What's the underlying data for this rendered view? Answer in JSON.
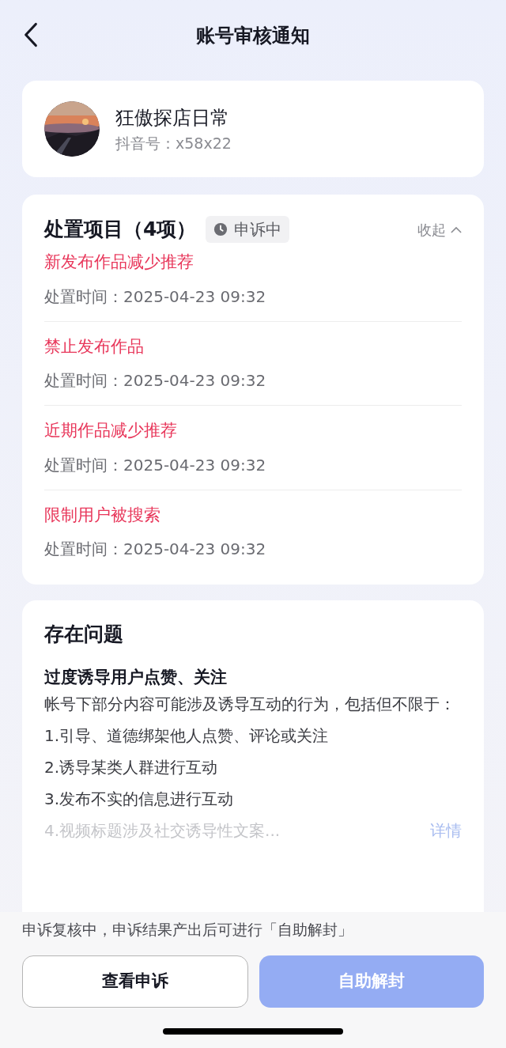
{
  "header": {
    "title": "账号审核通知"
  },
  "account": {
    "name": "狂傲探店日常",
    "id_label": "抖音号：x58x22"
  },
  "measures": {
    "title": "处置项目（4项）",
    "status": "申诉中",
    "toggle": "收起",
    "expanded": true,
    "items": [
      {
        "title": "新发布作品减少推荐",
        "time": "处置时间：2025-04-23 09:32"
      },
      {
        "title": "禁止发布作品",
        "time": "处置时间：2025-04-23 09:32"
      },
      {
        "title": "近期作品减少推荐",
        "time": "处置时间：2025-04-23 09:32"
      },
      {
        "title": "限制用户被搜索",
        "time": "处置时间：2025-04-23 09:32"
      }
    ]
  },
  "issues": {
    "title": "存在问题",
    "subtitle": "过度诱导用户点赞、关注",
    "description": "帐号下部分内容可能涉及诱导互动的行为，包括但不限于：",
    "points": [
      "1.引导、道德绑架他人点赞、评论或关注",
      "2.诱导某类人群进行互动",
      "3.发布不实的信息进行互动",
      "4.视频标题涉及社交诱导性文案..."
    ],
    "details_link": "详情"
  },
  "footer": {
    "notice": "申诉复核中，申诉结果产出后可进行「自助解封」",
    "buttons": [
      {
        "label": "查看申诉",
        "kind": "outline",
        "disabled": false
      },
      {
        "label": "自助解封",
        "kind": "primary",
        "disabled": true
      }
    ]
  }
}
